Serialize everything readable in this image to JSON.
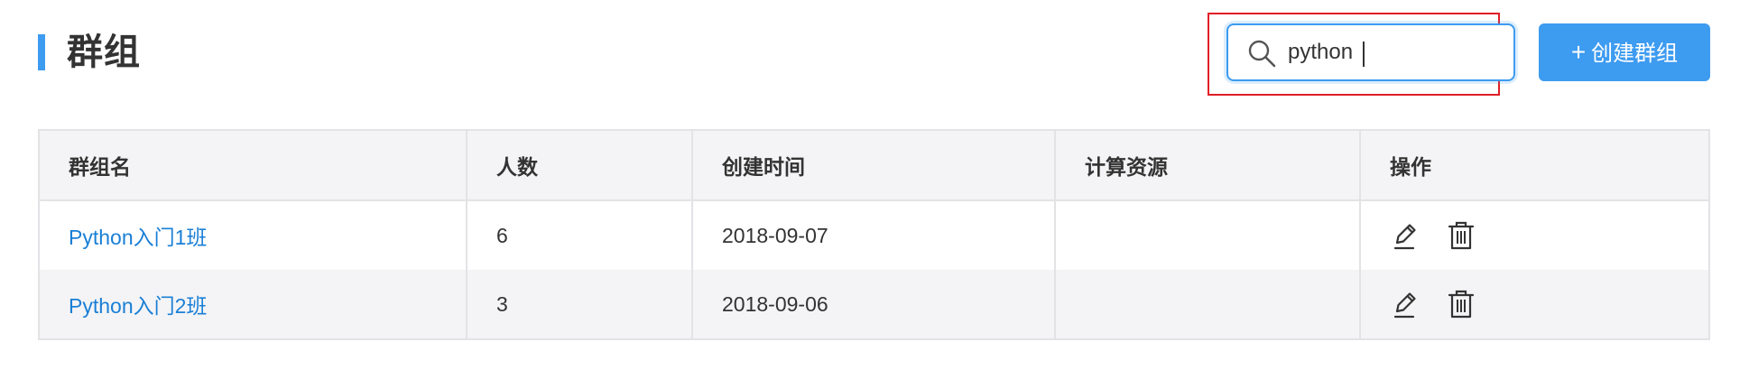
{
  "header": {
    "title": "群组"
  },
  "search": {
    "value": "python",
    "icon": "search-icon"
  },
  "create_button": {
    "icon": "plus-icon",
    "label": "创建群组"
  },
  "table": {
    "columns": [
      "群组名",
      "人数",
      "创建时间",
      "计算资源",
      "操作"
    ],
    "rows": [
      {
        "name": "Python入门1班",
        "count": "6",
        "created": "2018-09-07",
        "resource": ""
      },
      {
        "name": "Python入门2班",
        "count": "3",
        "created": "2018-09-06",
        "resource": ""
      }
    ],
    "actions": [
      "edit-icon",
      "delete-icon"
    ]
  },
  "colors": {
    "accent": "#3d9bf0",
    "link": "#1a7fd6",
    "highlight_outline": "#e01e26"
  }
}
